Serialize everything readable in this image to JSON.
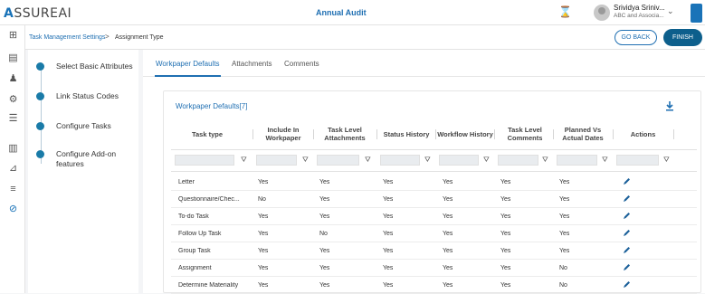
{
  "app": {
    "logo_text": "SSUREAI",
    "logo_mark": "A",
    "title": "Annual Audit",
    "user_name": "Srividya Sriniv...",
    "user_org": "ABC and Associa..."
  },
  "breadcrumb": {
    "item1": "Task Management Settings",
    "separator": ">",
    "item2": "Assignment Type"
  },
  "actions": {
    "go_back": "GO BACK",
    "finish": "FINISH"
  },
  "steps": [
    {
      "label": "Select Basic Attributes"
    },
    {
      "label": "Link Status Codes"
    },
    {
      "label": "Configure Tasks"
    },
    {
      "label": "Configure Add-on features"
    }
  ],
  "tabs": [
    {
      "label": "Workpaper Defaults"
    },
    {
      "label": "Attachments"
    },
    {
      "label": "Comments"
    }
  ],
  "card": {
    "title": "Workpaper Defaults[7]"
  },
  "table": {
    "headers": [
      "Task type",
      "Include In Workpaper",
      "Task Level Attachments",
      "Status History",
      "Workflow History",
      "Task Level Comments",
      "Planned Vs Actual Dates",
      "Actions"
    ],
    "rows": [
      {
        "c0": "Letter",
        "c1": "Yes",
        "c2": "Yes",
        "c3": "Yes",
        "c4": "Yes",
        "c5": "Yes",
        "c6": "Yes"
      },
      {
        "c0": "Questionnaire/Chec...",
        "c1": "No",
        "c2": "Yes",
        "c3": "Yes",
        "c4": "Yes",
        "c5": "Yes",
        "c6": "Yes"
      },
      {
        "c0": "To-do Task",
        "c1": "Yes",
        "c2": "Yes",
        "c3": "Yes",
        "c4": "Yes",
        "c5": "Yes",
        "c6": "Yes"
      },
      {
        "c0": "Follow Up Task",
        "c1": "Yes",
        "c2": "No",
        "c3": "Yes",
        "c4": "Yes",
        "c5": "Yes",
        "c6": "Yes"
      },
      {
        "c0": "Group Task",
        "c1": "Yes",
        "c2": "Yes",
        "c3": "Yes",
        "c4": "Yes",
        "c5": "Yes",
        "c6": "Yes"
      },
      {
        "c0": "Assignment",
        "c1": "Yes",
        "c2": "Yes",
        "c3": "Yes",
        "c4": "Yes",
        "c5": "Yes",
        "c6": "No"
      },
      {
        "c0": "Determine Materiality",
        "c1": "Yes",
        "c2": "Yes",
        "c3": "Yes",
        "c4": "Yes",
        "c5": "Yes",
        "c6": "No"
      }
    ]
  },
  "colors": {
    "accent": "#1f6fb2",
    "step_dot": "#1a7ba8",
    "finish_button": "#0d5f8c",
    "active_nav": "#1a73b8"
  },
  "icons": {
    "nav": [
      "grid-icon",
      "document-icon",
      "users-icon",
      "gear-icon",
      "list-icon",
      "chart-icon",
      "flow-icon",
      "checklist-icon",
      "check-circle-icon"
    ],
    "header": [
      "hourglass-icon",
      "avatar",
      "chevron-down-icon"
    ],
    "card": [
      "download-icon"
    ],
    "table": [
      "filter-icon",
      "edit-icon"
    ]
  }
}
